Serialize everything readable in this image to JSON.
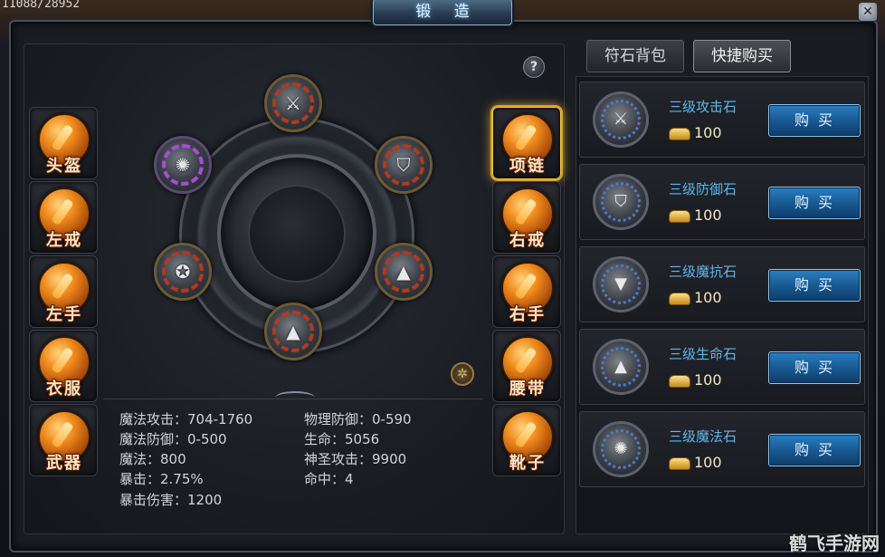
{
  "world": {
    "counter": "11088/28952"
  },
  "window": {
    "title": "锻 造",
    "close_glyph": "✕"
  },
  "help_glyph": "?",
  "equip_slots": {
    "left": [
      "头盔",
      "左戒",
      "左手",
      "衣服",
      "武器"
    ],
    "right": [
      "项链",
      "右戒",
      "右手",
      "腰带",
      "靴子"
    ],
    "active": "项链"
  },
  "gems": [
    {
      "slot": "top",
      "icon": "sword-icon",
      "glyph": "⚔"
    },
    {
      "slot": "upper-left",
      "icon": "magic-icon",
      "glyph": "✺"
    },
    {
      "slot": "upper-right",
      "icon": "shield-icon",
      "glyph": "⛉"
    },
    {
      "slot": "lower-left",
      "icon": "star-icon",
      "glyph": "✪"
    },
    {
      "slot": "lower-right",
      "icon": "triangle-icon",
      "glyph": "▲"
    },
    {
      "slot": "bottom",
      "icon": "mountain-icon",
      "glyph": "▲"
    }
  ],
  "stats": {
    "magic_attack": "魔法攻击：704-1760",
    "magic_defense": "魔法防御：0-500",
    "mana": "魔法：800",
    "crit": "暴击：2.75%",
    "crit_damage": "暴击伤害：1200",
    "phys_defense": "物理防御：0-590",
    "life": "生命：5056",
    "holy_attack": "神圣攻击：9900",
    "hit": "命中：4"
  },
  "tabs": {
    "runes": "符石背包",
    "quick_buy": "快捷购买",
    "active": "快捷购买"
  },
  "shop_items": [
    {
      "name": "三级攻击石",
      "price": "100",
      "button": "购买",
      "icon": "sword-icon",
      "glyph": "⚔"
    },
    {
      "name": "三级防御石",
      "price": "100",
      "button": "购买",
      "icon": "shield-icon",
      "glyph": "⛉"
    },
    {
      "name": "三级魔抗石",
      "price": "100",
      "button": "购买",
      "icon": "triangle-icon",
      "glyph": "▼"
    },
    {
      "name": "三级生命石",
      "price": "100",
      "button": "购买",
      "icon": "mountain-icon",
      "glyph": "▲"
    },
    {
      "name": "三级魔法石",
      "price": "100",
      "button": "购买",
      "icon": "magic-icon",
      "glyph": "✺"
    }
  ],
  "watermark": "鹤飞手游网",
  "colors": {
    "item_name": "#5fb6ea",
    "buy_button": "#185a93",
    "orb": "#f08a1c",
    "active_slot": "#f3c84a"
  }
}
